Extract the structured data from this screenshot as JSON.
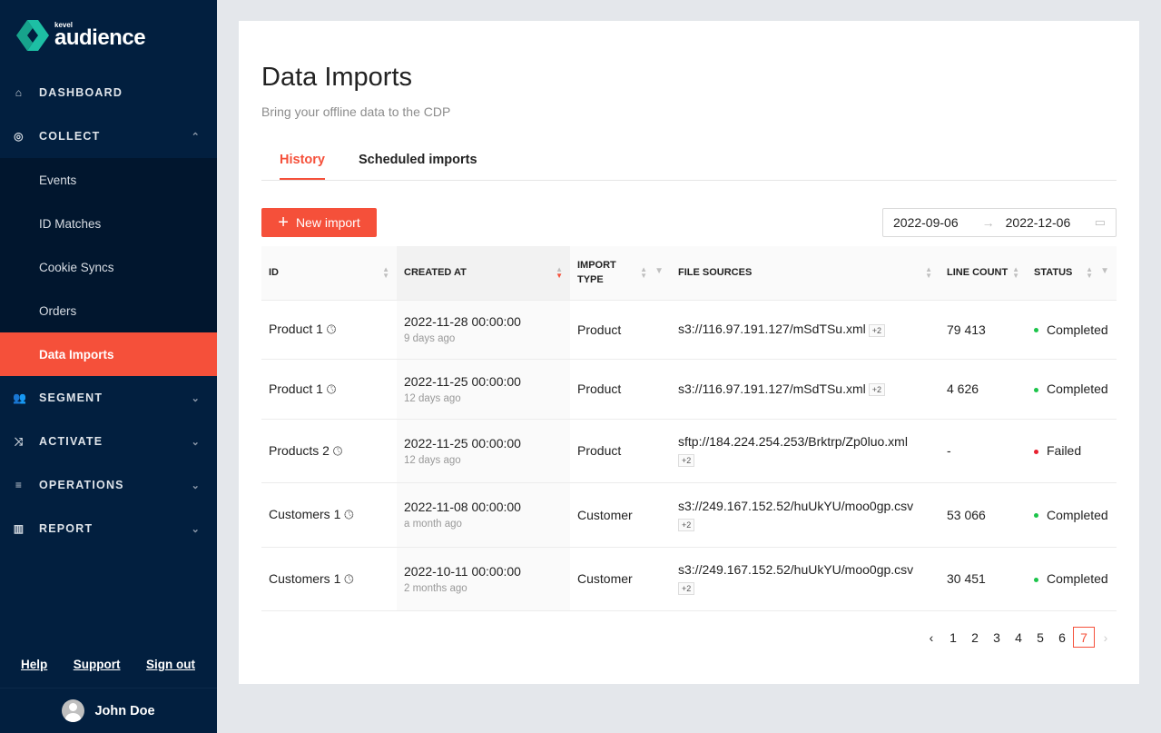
{
  "brand": {
    "small": "kevel",
    "name": "audience",
    "color": "#1dbfa4"
  },
  "nav": [
    {
      "label": "DASHBOARD",
      "icon": "home-icon"
    },
    {
      "label": "COLLECT",
      "icon": "target-icon",
      "expanded": true,
      "children": [
        {
          "label": "Events"
        },
        {
          "label": "ID Matches"
        },
        {
          "label": "Cookie Syncs"
        },
        {
          "label": "Orders"
        },
        {
          "label": "Data Imports",
          "active": true
        }
      ]
    },
    {
      "label": "SEGMENT",
      "icon": "users-icon"
    },
    {
      "label": "ACTIVATE",
      "icon": "shuffle-icon"
    },
    {
      "label": "OPERATIONS",
      "icon": "database-icon"
    },
    {
      "label": "REPORT",
      "icon": "bar-chart-icon"
    }
  ],
  "footer": {
    "help": "Help",
    "support": "Support",
    "signout": "Sign out",
    "user": "John Doe"
  },
  "page": {
    "title": "Data Imports",
    "subtitle": "Bring your offline data to the CDP",
    "tabs": [
      "History",
      "Scheduled imports"
    ],
    "new_import": "New import",
    "date_from": "2022-09-06",
    "date_to": "2022-12-06"
  },
  "table": {
    "headers": [
      "ID",
      "CREATED AT",
      "IMPORT TYPE",
      "FILE SOURCES",
      "LINE COUNT",
      "STATUS"
    ],
    "rows": [
      {
        "id": "Product 1",
        "created": "2022-11-28 00:00:00",
        "ago": "9 days ago",
        "type": "Product",
        "source": "s3://116.97.191.127/mSdTSu.xml",
        "more": "+2",
        "lines": "79 413",
        "status": "Completed"
      },
      {
        "id": "Product 1",
        "created": "2022-11-25 00:00:00",
        "ago": "12 days ago",
        "type": "Product",
        "source": "s3://116.97.191.127/mSdTSu.xml",
        "more": "+2",
        "lines": "4 626",
        "status": "Completed"
      },
      {
        "id": "Products 2",
        "created": "2022-11-25 00:00:00",
        "ago": "12 days ago",
        "type": "Product",
        "source": "sftp://184.224.254.253/Brktrp/Zp0luo.xml",
        "more": "+2",
        "lines": "-",
        "status": "Failed"
      },
      {
        "id": "Customers 1",
        "created": "2022-11-08 00:00:00",
        "ago": "a month ago",
        "type": "Customer",
        "source": "s3://249.167.152.52/huUkYU/moo0gp.csv",
        "more": "+2",
        "lines": "53 066",
        "status": "Completed"
      },
      {
        "id": "Customers 1",
        "created": "2022-10-11 00:00:00",
        "ago": "2 months ago",
        "type": "Customer",
        "source": "s3://249.167.152.52/huUkYU/moo0gp.csv",
        "more": "+2",
        "lines": "30 451",
        "status": "Completed"
      }
    ]
  },
  "status_colors": {
    "Completed": "#1cc44a",
    "Failed": "#e8202f"
  },
  "pagination": {
    "pages": [
      "1",
      "2",
      "3",
      "4",
      "5",
      "6",
      "7"
    ],
    "current": "7"
  }
}
